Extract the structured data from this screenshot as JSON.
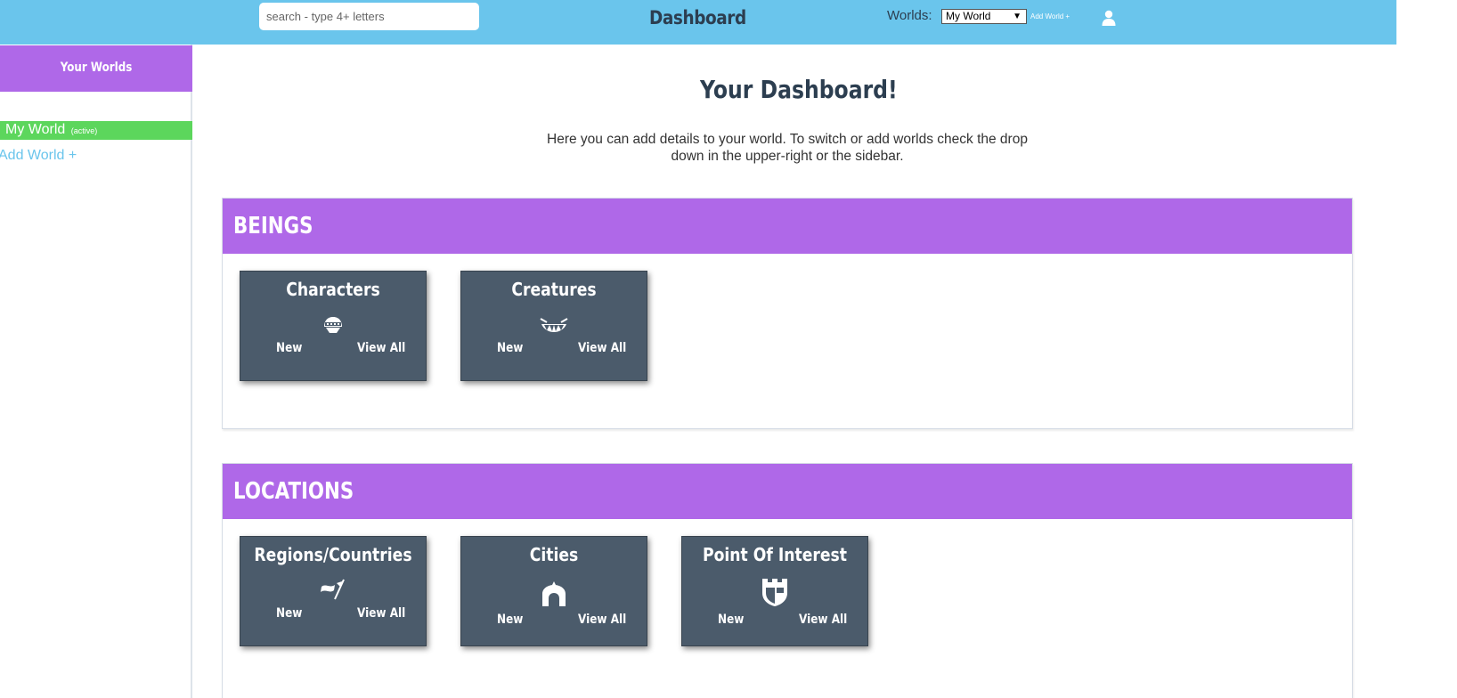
{
  "header": {
    "search_placeholder": "search - type 4+ letters",
    "title": "Dashboard",
    "worlds_label": "Worlds:",
    "worlds_selected": "My World",
    "add_world": "Add World +",
    "user_icon": "user-icon"
  },
  "sidebar": {
    "title": "Your Worlds",
    "world_name": "My World",
    "world_status": "(active)",
    "add_world": "Add World +"
  },
  "main": {
    "title": "Your Dashboard!",
    "intro": "Here you can add details to your world. To switch or add worlds check the drop down in the upper-right or the sidebar."
  },
  "sections": {
    "beings": {
      "title": "BEINGS",
      "cards": [
        {
          "title": "Characters",
          "icon": "character-icon",
          "new": "New",
          "view": "View All"
        },
        {
          "title": "Creatures",
          "icon": "creature-icon",
          "new": "New",
          "view": "View All"
        }
      ]
    },
    "locations": {
      "title": "LOCATIONS",
      "cards": [
        {
          "title": "Regions/Countries",
          "icon": "flag-icon",
          "new": "New",
          "view": "View All"
        },
        {
          "title": "Cities",
          "icon": "city-gate-icon",
          "new": "New",
          "view": "View All"
        },
        {
          "title": "Point Of Interest",
          "icon": "castle-shield-icon",
          "new": "New",
          "view": "View All"
        }
      ]
    }
  },
  "colors": {
    "topbar": "#6ac5ec",
    "purple": "#af68e8",
    "card": "#4b5b6b",
    "active_green": "#5cd65c"
  }
}
